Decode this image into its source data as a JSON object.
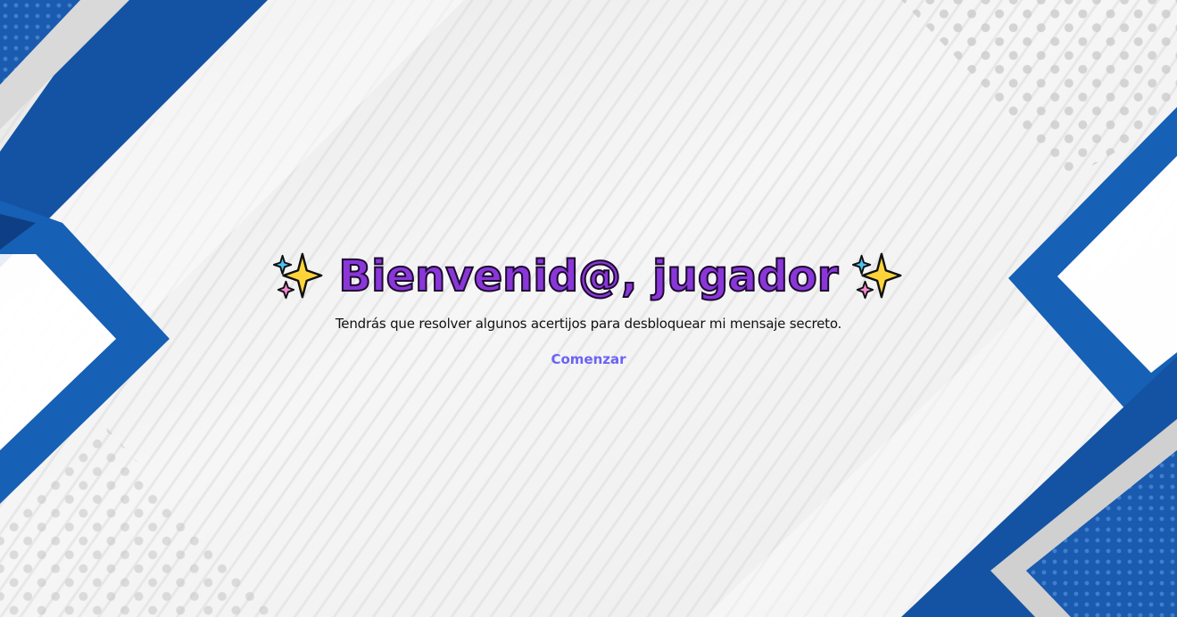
{
  "page": {
    "title": "Bienvenid@, jugador",
    "subtitle": "Tendrás que resolver algunos acertijos para desbloquear mi mensaje secreto.",
    "start_link": "Comenzar"
  },
  "icons": {
    "left_emoji": "sparkles-icon",
    "right_emoji": "sparkles-icon"
  },
  "colors": {
    "title": "#8a36d9",
    "title_outline": "#1c0a2e",
    "subtitle": "#111111",
    "link": "#6b63f5",
    "frame_blue": "#1453a3",
    "background": "#f1f1f1"
  }
}
